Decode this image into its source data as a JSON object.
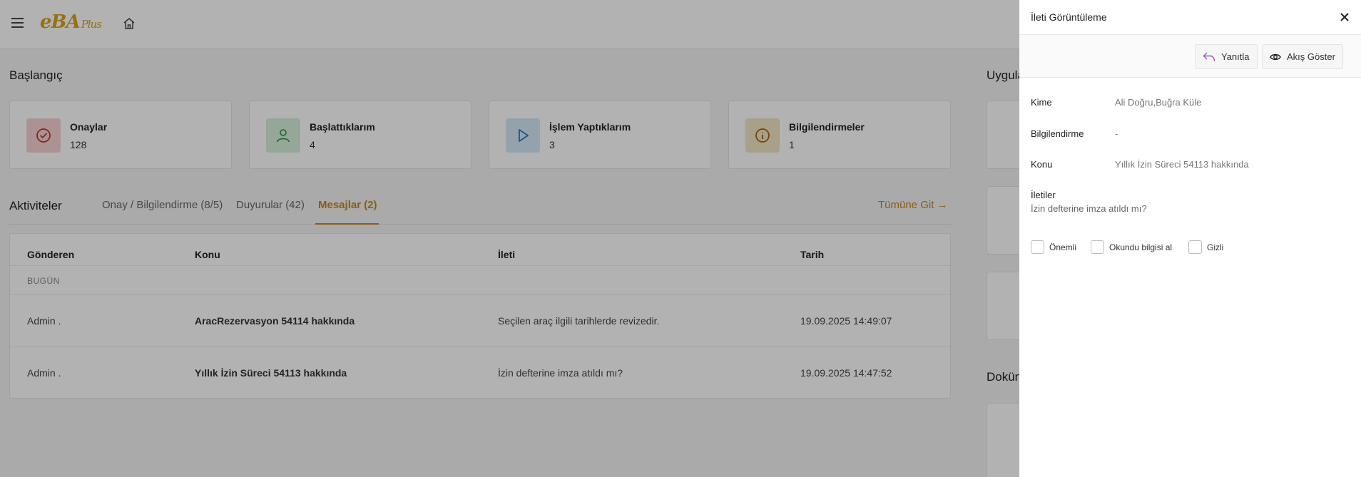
{
  "app": {
    "logo_text": "eBA",
    "logo_plus": "Plus"
  },
  "start": {
    "title": "Başlangıç",
    "cards": [
      {
        "label": "Onaylar",
        "count": "128",
        "icon": "check-circle-icon",
        "color": "#f7d3d3",
        "icon_color": "#c0392b"
      },
      {
        "label": "Başlattıklarım",
        "count": "4",
        "icon": "user-icon",
        "color": "#d7f0dc",
        "icon_color": "#2e9e4f"
      },
      {
        "label": "İşlem Yaptıklarım",
        "count": "3",
        "icon": "play-icon",
        "color": "#d4e8f7",
        "icon_color": "#2a7bbf"
      },
      {
        "label": "Bilgilendirmeler",
        "count": "1",
        "icon": "info-icon",
        "color": "#f3e6c6",
        "icon_color": "#9a6b10"
      }
    ]
  },
  "activities": {
    "title": "Aktiviteler",
    "tabs": [
      "Onay / Bilgilendirme (8/5)",
      "Duyurular (42)",
      "Mesajlar (2)"
    ],
    "active_tab": "Mesajlar (2)",
    "goto_label": "Tümüne Git →",
    "columns": [
      "Gönderen",
      "Konu",
      "İleti",
      "Tarih"
    ],
    "group_label": "BUGÜN",
    "rows": [
      {
        "sender": "Admin .",
        "subject": "AracRezervasyon 54114 hakkında",
        "message": "Seçilen araç ilgili tarihlerde revizedir.",
        "date": "19.09.2025 14:49:07"
      },
      {
        "sender": "Admin .",
        "subject": "Yıllık İzin Süreci 54113 hakkında",
        "message": "İzin defterine imza atıldı mı?",
        "date": "19.09.2025 14:47:52"
      }
    ]
  },
  "right_column": {
    "apps_title": "Uygula",
    "docs_title": "Dokün"
  },
  "drawer": {
    "title": "İleti Görüntüleme",
    "reply_label": "Yanıtla",
    "flow_label": "Akış Göster",
    "fields": [
      {
        "label": "Kime",
        "value": "Ali Doğru,Buğra Küle"
      },
      {
        "label": "Bilgilendirme",
        "value": "-"
      },
      {
        "label": "Konu",
        "value": "Yıllık İzin Süreci 54113 hakkında"
      }
    ],
    "messages_label": "İletiler",
    "message_text": "İzin defterine imza atıldı mı?",
    "checkboxes": [
      "Önemli",
      "Okundu bilgisi al",
      "Gizli"
    ],
    "reply_icon_color": "#9b59b6"
  }
}
